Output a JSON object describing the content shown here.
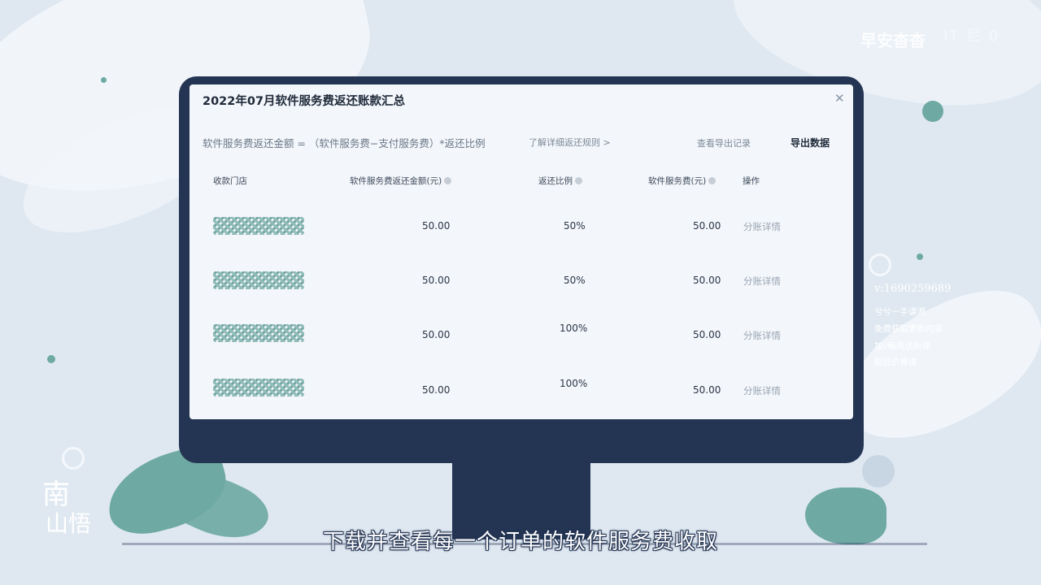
{
  "watermark": {
    "brand": "早安杳杳",
    "faint": "IT 尼 0"
  },
  "dialog": {
    "title": "2022年07月软件服务费返还账款汇总",
    "formula": "软件服务费返还金额 = （软件服务费−支付服务费）*返还比例",
    "rule_link": "了解详细返还规则 >",
    "export_history": "查看导出记录",
    "export_data": "导出数据",
    "columns": [
      "收款门店",
      "软件服务费返还金额(元)",
      "返还比例",
      "软件服务费(元)",
      "操作"
    ],
    "rows": [
      {
        "refund": "50.00",
        "ratio": "50%",
        "fee": "50.00",
        "action": "分账详情"
      },
      {
        "refund": "50.00",
        "ratio": "50%",
        "fee": "50.00",
        "action": "分账详情"
      },
      {
        "refund": "50.00",
        "ratio": "100%",
        "fee": "50.00",
        "action": "分账详情"
      },
      {
        "refund": "50.00",
        "ratio": "100%",
        "fee": "50.00",
        "action": "分账详情"
      }
    ]
  },
  "contact": {
    "vid": "v:1690259689",
    "lines": [
      "兮兮一手课源",
      "免费获取更新内容",
      "加v每周送新课",
      "超低价筹课"
    ]
  },
  "logo": {
    "line1": "南",
    "line2": "山悟"
  },
  "subtitle": "下载并查看每一个订单的软件服务费收取",
  "colors": {
    "monitor": "#243453",
    "accent": "#6ea9a3",
    "background": "#dfe8f1"
  }
}
